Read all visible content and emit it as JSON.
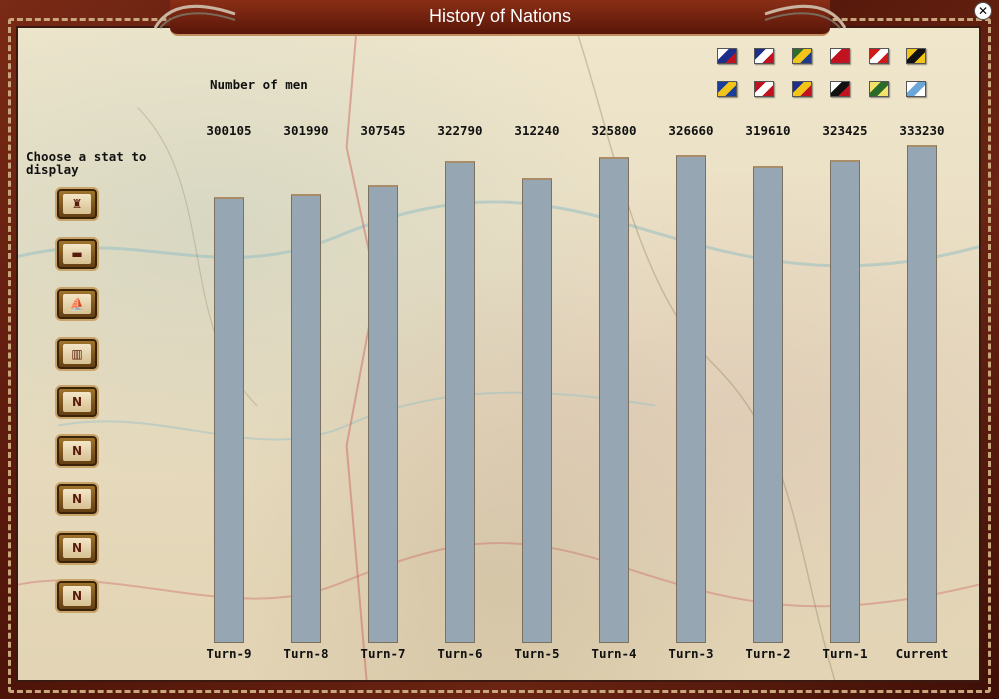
{
  "window": {
    "title": "History of Nations",
    "close_symbol": "✕"
  },
  "sidebar": {
    "label": "Choose a stat to display",
    "buttons": [
      {
        "icon": "soldier-portrait-icon",
        "symbol": "♜"
      },
      {
        "icon": "cannon-icon",
        "symbol": "▬"
      },
      {
        "icon": "ship-icon",
        "symbol": "⛵"
      },
      {
        "icon": "books-icon",
        "symbol": "▥"
      },
      {
        "icon": "n-infantry-icon",
        "symbol": "N"
      },
      {
        "icon": "n-cavalry-icon",
        "symbol": "N"
      },
      {
        "icon": "n-artillery-icon",
        "symbol": "N"
      },
      {
        "icon": "n-casualties-icon",
        "symbol": "N"
      },
      {
        "icon": "n-flag-icon",
        "symbol": "N"
      }
    ]
  },
  "flags": [
    {
      "name": "france-flag-icon",
      "colors": [
        "#ffffff",
        "#1d2f8a",
        "#c1121f"
      ]
    },
    {
      "name": "britain-flag-icon",
      "colors": [
        "#1d2f8a",
        "#ffffff",
        "#c1121f"
      ]
    },
    {
      "name": "portugal-flag-icon",
      "colors": [
        "#2f6b2a",
        "#f0c419",
        "#1b3a8a"
      ]
    },
    {
      "name": "spain-flag-icon",
      "colors": [
        "#ffffff",
        "#c1121f",
        "#c1121f"
      ]
    },
    {
      "name": "turkey-flag-icon",
      "colors": [
        "#d01a1a",
        "#ffffff",
        "#d01a1a"
      ]
    },
    {
      "name": "austria-flag-icon",
      "colors": [
        "#f2c418",
        "#111111",
        "#f2c418"
      ]
    },
    {
      "name": "sweden-flag-icon",
      "colors": [
        "#1b3e9a",
        "#f2c418",
        "#1b3e9a"
      ]
    },
    {
      "name": "denmark-flag-icon",
      "colors": [
        "#c1121f",
        "#ffffff",
        "#c1121f"
      ]
    },
    {
      "name": "russia-flag-icon",
      "colors": [
        "#1d2f8a",
        "#f2c418",
        "#c1121f"
      ]
    },
    {
      "name": "prussia-flag-icon",
      "colors": [
        "#ffffff",
        "#111111",
        "#c1121f"
      ]
    },
    {
      "name": "kingdom-flag-icon",
      "colors": [
        "#f2e26a",
        "#2a6a2a",
        "#f2e26a"
      ]
    },
    {
      "name": "naples-flag-icon",
      "colors": [
        "#ffffff",
        "#6aa7d8",
        "#ffffff"
      ]
    }
  ],
  "chart_data": {
    "type": "bar",
    "title": "",
    "ylabel": "Number of men",
    "xlabel": "",
    "categories": [
      "Turn-9",
      "Turn-8",
      "Turn-7",
      "Turn-6",
      "Turn-5",
      "Turn-4",
      "Turn-3",
      "Turn-2",
      "Turn-1",
      "Current"
    ],
    "values": [
      300105,
      301990,
      307545,
      322790,
      312240,
      325800,
      326660,
      319610,
      323425,
      333230
    ],
    "value_labels": [
      "300105",
      "301990",
      "307545",
      "322790",
      "312240",
      "325800",
      "326660",
      "319610",
      "323425",
      "333230"
    ],
    "bar_color": "#96a6b3",
    "ylim": [
      0,
      333230
    ]
  }
}
